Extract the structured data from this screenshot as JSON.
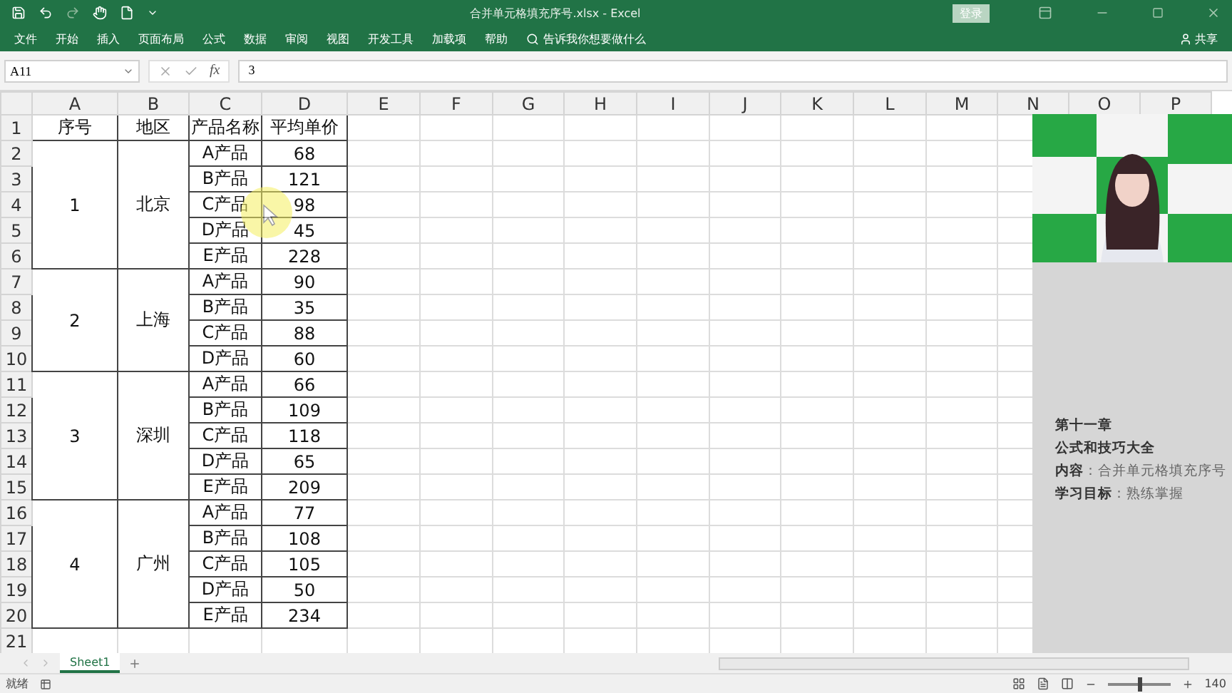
{
  "window": {
    "title": "合并单元格填充序号.xlsx - Excel",
    "login": "登录"
  },
  "menu": {
    "items": [
      "文件",
      "开始",
      "插入",
      "页面布局",
      "公式",
      "数据",
      "审阅",
      "视图",
      "开发工具",
      "加载项",
      "帮助"
    ],
    "search": "告诉我你想要做什么",
    "share": "共享"
  },
  "formula_bar": {
    "name_box": "A11",
    "function_label": "fx",
    "value": "3"
  },
  "columns": [
    "A",
    "B",
    "C",
    "D",
    "E",
    "F",
    "G",
    "H",
    "I",
    "J",
    "K",
    "L",
    "M",
    "N",
    "O",
    "P"
  ],
  "header_row": {
    "row": "1",
    "cells": [
      "序号",
      "地区",
      "产品名称",
      "平均单价"
    ]
  },
  "groups": [
    {
      "seq": "1",
      "region": "北京",
      "items": [
        {
          "row": "2",
          "name": "A产品",
          "price": "68"
        },
        {
          "row": "3",
          "name": "B产品",
          "price": "121"
        },
        {
          "row": "4",
          "name": "C产品",
          "price": "98"
        },
        {
          "row": "5",
          "name": "D产品",
          "price": "45"
        },
        {
          "row": "6",
          "name": "E产品",
          "price": "228"
        }
      ]
    },
    {
      "seq": "2",
      "region": "上海",
      "items": [
        {
          "row": "7",
          "name": "A产品",
          "price": "90"
        },
        {
          "row": "8",
          "name": "B产品",
          "price": "35"
        },
        {
          "row": "9",
          "name": "C产品",
          "price": "88"
        },
        {
          "row": "10",
          "name": "D产品",
          "price": "60"
        }
      ]
    },
    {
      "seq": "3",
      "region": "深圳",
      "items": [
        {
          "row": "11",
          "name": "A产品",
          "price": "66"
        },
        {
          "row": "12",
          "name": "B产品",
          "price": "109"
        },
        {
          "row": "13",
          "name": "C产品",
          "price": "118"
        },
        {
          "row": "14",
          "name": "D产品",
          "price": "65"
        },
        {
          "row": "15",
          "name": "E产品",
          "price": "209"
        }
      ]
    },
    {
      "seq": "4",
      "region": "广州",
      "items": [
        {
          "row": "16",
          "name": "A产品",
          "price": "77"
        },
        {
          "row": "17",
          "name": "B产品",
          "price": "108"
        },
        {
          "row": "18",
          "name": "C产品",
          "price": "105"
        },
        {
          "row": "19",
          "name": "D产品",
          "price": "50"
        },
        {
          "row": "20",
          "name": "E产品",
          "price": "234"
        }
      ]
    }
  ],
  "empty_rows": [
    "21"
  ],
  "side_panel": {
    "chapter": "第十一章",
    "title": "公式和技巧大全",
    "lines": [
      "**内容**：合并单元格填充序号",
      "**学习目标**：熟练掌握"
    ]
  },
  "sheet_tabs": [
    {
      "label": "Sheet1",
      "selected": true
    }
  ],
  "status_bar": {
    "status": "就绪",
    "level": 0.5,
    "zoom": "140"
  }
}
